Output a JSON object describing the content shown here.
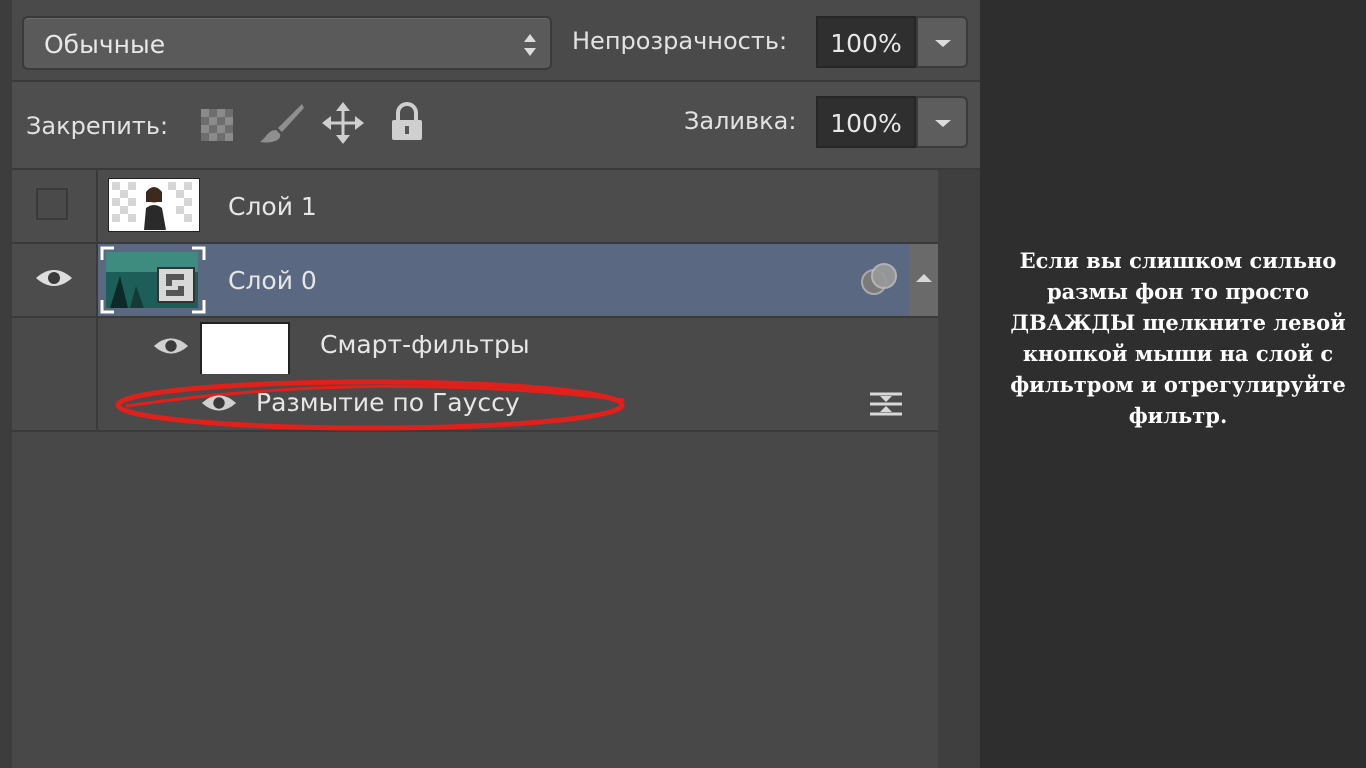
{
  "blend_mode": {
    "value": "Обычные"
  },
  "opacity": {
    "label": "Непрозрачность:",
    "value": "100%"
  },
  "lock": {
    "label": "Закрепить:",
    "icons": [
      "lock-transparent-pixels-icon",
      "lock-image-pixels-icon",
      "lock-position-icon",
      "lock-all-icon"
    ]
  },
  "fill": {
    "label": "Заливка:",
    "value": "100%"
  },
  "layers": [
    {
      "name": "Слой 1",
      "visible": false
    },
    {
      "name": "Слой 0",
      "visible": true,
      "selected": true
    },
    {
      "name": "Смарт-фильтры",
      "visible": true
    },
    {
      "name": "Размытие по Гауссу",
      "visible": true
    }
  ],
  "caption": {
    "text": "Если вы слишком сильно размы фон то просто ДВАЖДЫ щелкните левой кнопкой мыши на слой с фильтром и отрегулируйте фильтр."
  },
  "colors": {
    "selected_row": "#5a6882",
    "highlight_ellipse": "#e0201a"
  }
}
